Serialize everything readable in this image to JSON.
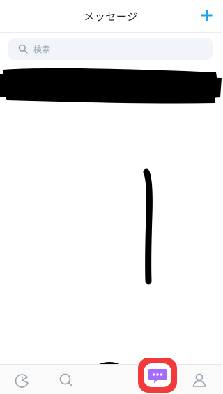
{
  "header": {
    "title": "メッセージ",
    "new_message_icon": "plus-icon",
    "accent_color": "#1da1f2"
  },
  "search": {
    "placeholder": "検索",
    "icon": "search-icon"
  },
  "tab_bar": {
    "items": [
      {
        "icon": "home-icon"
      },
      {
        "icon": "search-icon"
      },
      {
        "icon": "redacted-item"
      },
      {
        "icon": "chat-bubble-icon",
        "active": true
      },
      {
        "icon": "person-icon"
      }
    ],
    "active_color": "#a46bff",
    "highlight_color": "#f23a3a"
  }
}
